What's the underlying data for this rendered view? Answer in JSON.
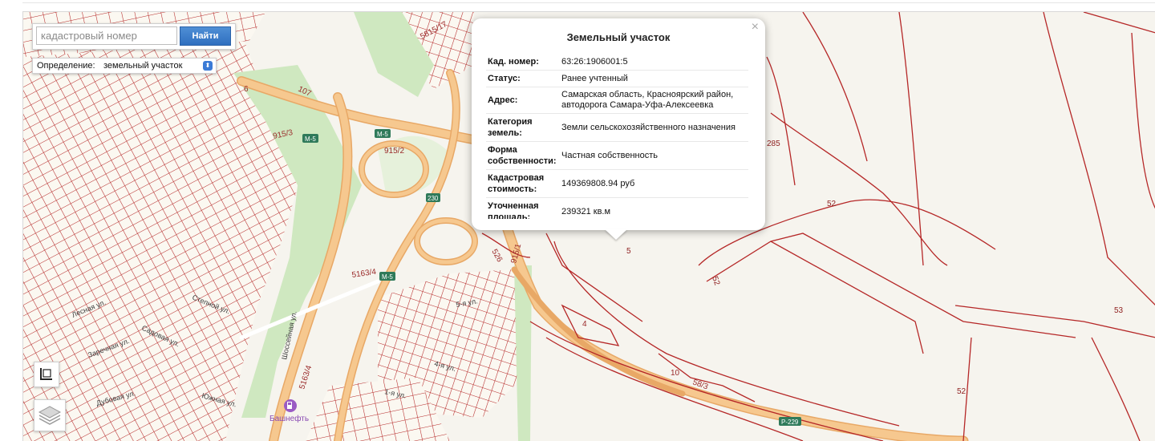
{
  "search": {
    "placeholder": "кадастровый номер",
    "button_label": "Найти"
  },
  "definition": {
    "label": "Определение:",
    "selected": "земельный участок"
  },
  "popup": {
    "close_glyph": "×",
    "title": "Земельный участок",
    "rows": [
      {
        "key": "Кад. номер:",
        "value": "63:26:1906001:5"
      },
      {
        "key": "Статус:",
        "value": "Ранее учтенный"
      },
      {
        "key": "Адрес:",
        "value": "Самарская область, Красноярский район, автодорога Самара-Уфа-Алексеевка"
      },
      {
        "key": "Категория земель:",
        "value": "Земли сельскохозяйственного назначения"
      },
      {
        "key": "Форма собственности:",
        "value": "Частная собственность"
      },
      {
        "key": "Кадастровая стоимость:",
        "value": "149369808.94 руб"
      },
      {
        "key": "Уточненная площадь:",
        "value": "239321 кв.м"
      }
    ]
  },
  "map_labels": {
    "l5815": "5815/17",
    "l6": "6",
    "l107": "107",
    "l915_3": "915/3",
    "l915_2": "915/2",
    "l285": "285",
    "l52a": "52",
    "l52b": "52",
    "l52c": "52",
    "l53": "53",
    "l5": "5",
    "l4": "4",
    "l10": "10",
    "l58_3": "58/3",
    "l526": "526",
    "l915_1": "915/1",
    "l5163_4a": "5163/4",
    "l5163_4b": "5163/4",
    "shield_m5a": "М-5",
    "shield_m5b": "М-5",
    "shield_m5c": "М-5",
    "shield_230": "230",
    "shield_r229": "Р-229",
    "poi_name": "Башнефть"
  },
  "streets": {
    "s1": "Степной ул.",
    "s2": "Шоссейная ул.",
    "s3": "Лесная ул.",
    "s4": "Садовая ул.",
    "s5": "Заречная ул.",
    "s6": "Южная ул.",
    "s7": "Дубовая ул.",
    "s8": "1-я ул.",
    "s9": "5-я ул.",
    "s10": "4-я ул."
  },
  "icons": {
    "select_chevron": "chevron-updown-icon",
    "ruler": "ruler-icon",
    "layers": "layers-icon",
    "poi": "fuel-station-icon"
  },
  "colors": {
    "parcel_border": "#b52727",
    "road_major": "#f6c88f",
    "road_minor": "#ffffff",
    "greenery": "#cfe8c0",
    "accent_button": "#2f6fbf"
  }
}
